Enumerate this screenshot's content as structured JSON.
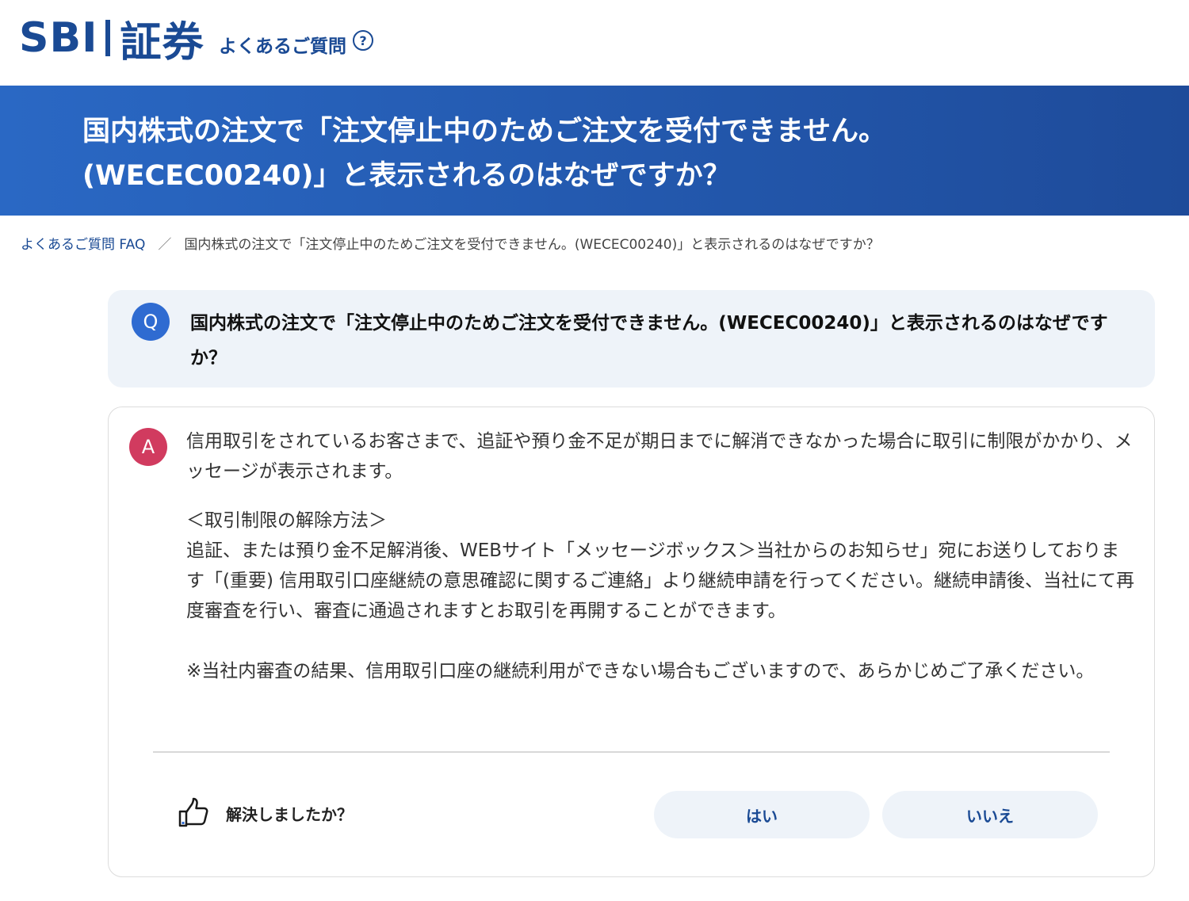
{
  "header": {
    "logo_text": "SBI証券",
    "faq_link": "よくあるご質問",
    "faq_icon": "question-circle-icon"
  },
  "banner": {
    "title": "国内株式の注文で「注文停止中のためご注文を受付できません。(WECEC00240)」と表示されるのはなぜですか？"
  },
  "breadcrumb": {
    "home": "よくあるご質問 FAQ",
    "separator": "／",
    "current": "国内株式の注文で「注文停止中のためご注文を受付できません。(WECEC00240)」と表示されるのはなぜですか？"
  },
  "question": {
    "badge": "Q",
    "badge_color": "#2f6bd1",
    "text": "国内株式の注文で「注文停止中のためご注文を受付できません。(WECEC00240)」と表示されるのはなぜですか？"
  },
  "answer": {
    "badge": "A",
    "badge_color": "#d13b5f",
    "paragraph1": "信用取引をされているお客さまで、追証や預り金不足が期日までに解消できなかった場合に取引に制限がかかり、メッセージが表示されます。",
    "section_title": "＜取引制限の解除方法＞",
    "paragraph2": "追証、または預り金不足解消後、WEBサイト「メッセージボックス＞当社からのお知らせ」宛にお送りしております「(重要) 信用取引口座継続の意思確認に関するご連絡」より継続申請を行ってください。継続申請後、当社にて再度審査を行い、審査に通過されますとお取引を再開することができます。",
    "note": "※当社内審査の結果、信用取引口座の継続利用ができない場合もございますので、あらかじめご了承ください。"
  },
  "feedback": {
    "icon": "thumbs-up-icon",
    "label": "解決しましたか？",
    "yes_label": "はい",
    "no_label": "いいえ"
  },
  "colors": {
    "brand": "#1a4a94",
    "banner_start": "#2a68c4",
    "banner_end": "#1e4b9a",
    "card_bg": "#eef3f9"
  }
}
